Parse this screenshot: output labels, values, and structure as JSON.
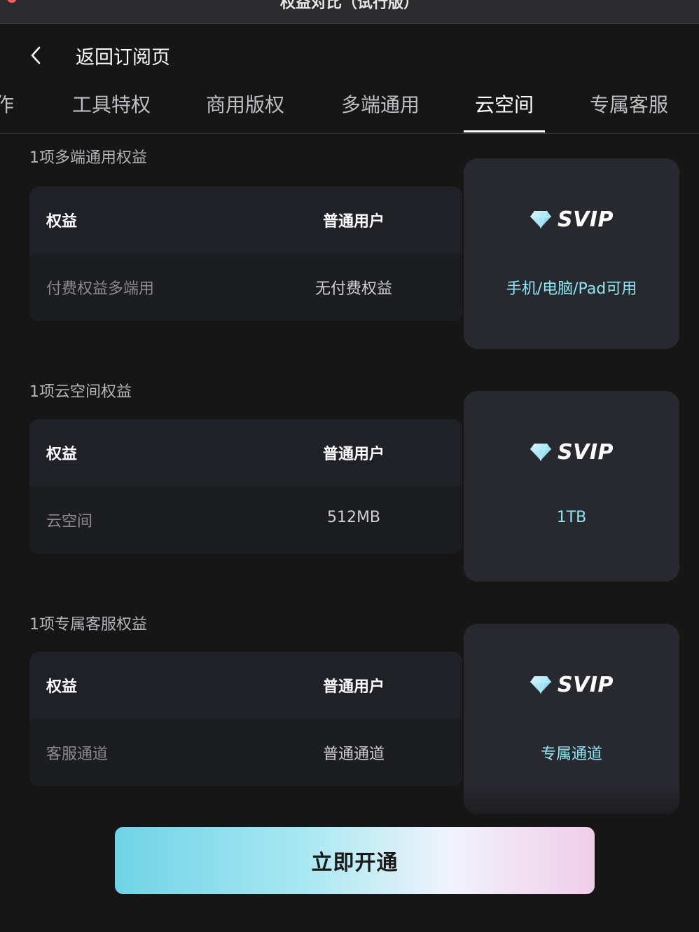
{
  "window": {
    "title": "权益对比（试行版）"
  },
  "header": {
    "back_label": "返回订阅页"
  },
  "tabs": [
    {
      "label": "作"
    },
    {
      "label": "工具特权"
    },
    {
      "label": "商用版权"
    },
    {
      "label": "多端通用"
    },
    {
      "label": "云空间",
      "active": true
    },
    {
      "label": "专属客服"
    }
  ],
  "sections": [
    {
      "title": "1项多端通用权益",
      "header": {
        "benefit": "权益",
        "normal": "普通用户"
      },
      "row": {
        "benefit": "付费权益多端用",
        "normal": "无付费权益"
      },
      "svip": {
        "label": "SVIP",
        "value": "手机/电脑/Pad可用"
      }
    },
    {
      "title": "1项云空间权益",
      "header": {
        "benefit": "权益",
        "normal": "普通用户"
      },
      "row": {
        "benefit": "云空间",
        "normal": "512MB"
      },
      "svip": {
        "label": "SVIP",
        "value": "1TB"
      }
    },
    {
      "title": "1项专属客服权益",
      "header": {
        "benefit": "权益",
        "normal": "普通用户"
      },
      "row": {
        "benefit": "客服通道",
        "normal": "普通通道"
      },
      "svip": {
        "label": "SVIP",
        "value": "专属通道"
      }
    }
  ],
  "cta": {
    "label": "立即开通"
  },
  "icons": {
    "back": "chevron-left-icon",
    "svip": "diamond-icon"
  },
  "colors": {
    "accent": "#8ee6f3",
    "background": "#161617",
    "card": "#28292f"
  }
}
